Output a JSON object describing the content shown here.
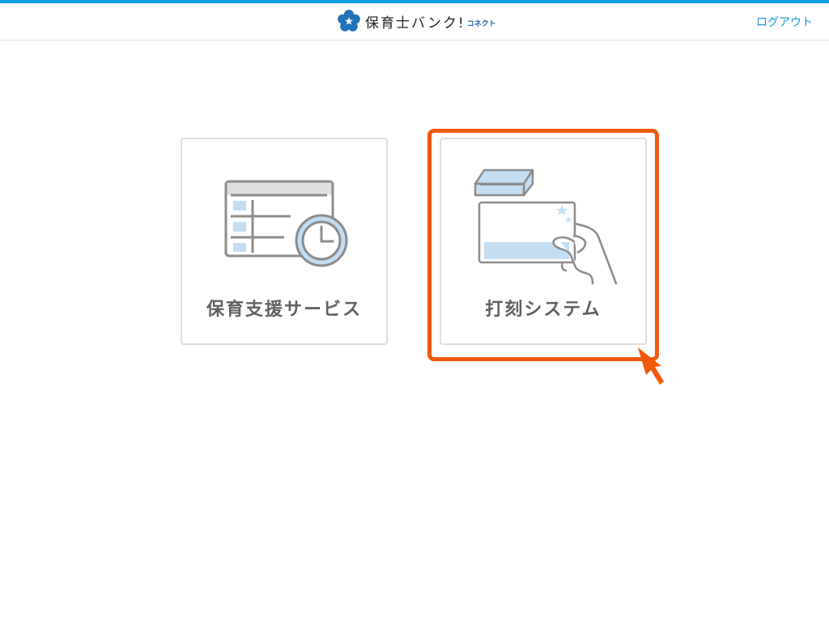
{
  "header": {
    "logo_text": "保育士バンク!",
    "logo_sub": "コネクト",
    "logout_label": "ログアウト",
    "accent_color": "#0c9ee6"
  },
  "cards": [
    {
      "label": "保育支援サービス",
      "icon": "schedule-table-clock-icon"
    },
    {
      "label": "打刻システム",
      "icon": "card-reader-hand-icon"
    }
  ],
  "annotation": {
    "highlight_color": "#f05a0a",
    "highlight_target": "打刻システム",
    "pointer_icon": "arrow-pointer-icon"
  }
}
